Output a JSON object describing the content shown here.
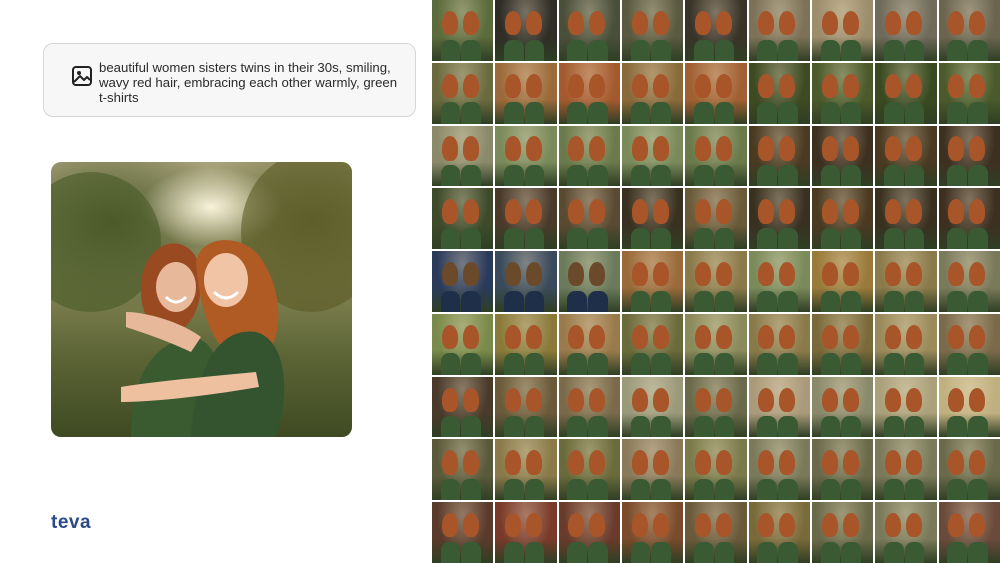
{
  "prompt": {
    "icon": "image-icon",
    "text": "beautiful women sisters twins in their 30s, smiling, wavy red hair, embracing each other warmly, green t-shirts"
  },
  "hero_image": {
    "icon": "photo-hero"
  },
  "logo": {
    "text": "teva"
  },
  "grid": {
    "columns": 9,
    "rows": 9,
    "palette_rows": [
      [
        "#5b6b3b",
        "#2f2d26",
        "#4a4f3a",
        "#5a5a40",
        "#3a3328",
        "#7d7258",
        "#9c8d6c",
        "#6f6a5a",
        "#6b6550"
      ],
      [
        "#6b6a3f",
        "#9c6a3a",
        "#a45a2e",
        "#8a6a3a",
        "#a06032",
        "#3e4a22",
        "#4b5a2a",
        "#3a4a20",
        "#4a5a2a"
      ],
      [
        "#8a8a6a",
        "#7a8a5a",
        "#6b7a4a",
        "#7a8a5a",
        "#6b7a4a",
        "#4a3a22",
        "#3e3020",
        "#4a3a22",
        "#3e3020"
      ],
      [
        "#3e4a2a",
        "#4a3a2a",
        "#5a4a32",
        "#3a3020",
        "#6a5a3a",
        "#3a3020",
        "#4a3a22",
        "#3a3020",
        "#3e3020"
      ],
      [
        "#2a3a5a",
        "#3a4a5a",
        "#6a7a5a",
        "#9a6a3a",
        "#8a7a4a",
        "#7a8a5a",
        "#9a7a3a",
        "#8a7a4a",
        "#7a7a5a"
      ],
      [
        "#7a8a4a",
        "#8a7a3a",
        "#9a7a4a",
        "#6a6a3a",
        "#8a8a5a",
        "#8a7a4a",
        "#7a6a3a",
        "#9a8a5a",
        "#7a6a4a"
      ],
      [
        "#4a3a2a",
        "#6a5a3a",
        "#7a6a4a",
        "#9a9a7a",
        "#6a6a4a",
        "#aa9a7a",
        "#8a8a6a",
        "#aaa07a",
        "#c0b080"
      ],
      [
        "#5a5a3a",
        "#8a7a4a",
        "#6a6a3a",
        "#8a7a5a",
        "#7a7a4a",
        "#7a7a5a",
        "#6a6a4a",
        "#7a7a5a",
        "#6a6a4a"
      ],
      [
        "#5a3a2a",
        "#7a3a2a",
        "#6a3a2a",
        "#7a4a2a",
        "#6a5a3a",
        "#7a6a3a",
        "#6a6a4a",
        "#7a7a5a",
        "#6a4a3a"
      ]
    ]
  }
}
